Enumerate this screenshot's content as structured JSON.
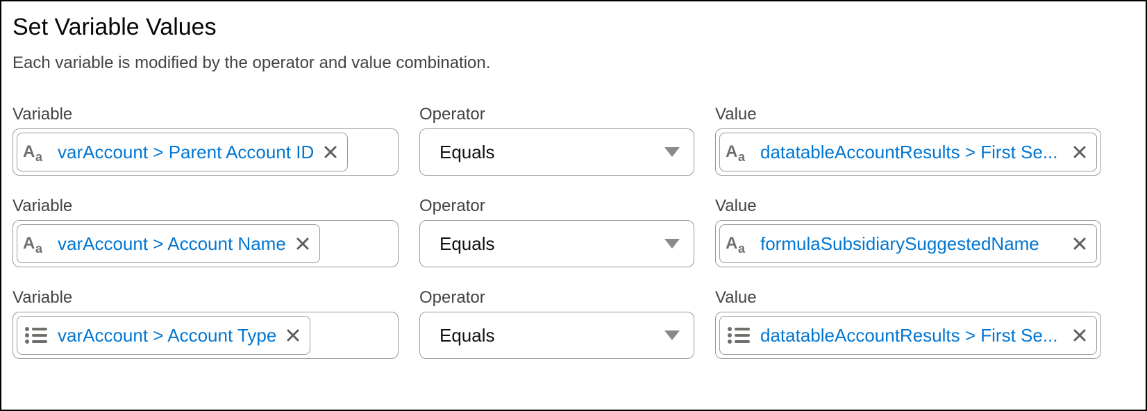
{
  "header": {
    "title": "Set Variable Values",
    "description": "Each variable is modified by the operator and value combination."
  },
  "labels": {
    "variable": "Variable",
    "operator": "Operator",
    "value": "Value"
  },
  "rows": [
    {
      "variable": {
        "text": "varAccount > Parent Account ID",
        "icon": "text"
      },
      "operator": "Equals",
      "value": {
        "text": "datatableAccountResults > First Se...",
        "icon": "text",
        "full": true
      }
    },
    {
      "variable": {
        "text": "varAccount > Account Name",
        "icon": "text"
      },
      "operator": "Equals",
      "value": {
        "text": "formulaSubsidiarySuggestedName",
        "icon": "text",
        "full": true
      }
    },
    {
      "variable": {
        "text": "varAccount > Account Type",
        "icon": "picklist"
      },
      "operator": "Equals",
      "value": {
        "text": "datatableAccountResults > First Se...",
        "icon": "picklist",
        "full": true
      }
    }
  ]
}
